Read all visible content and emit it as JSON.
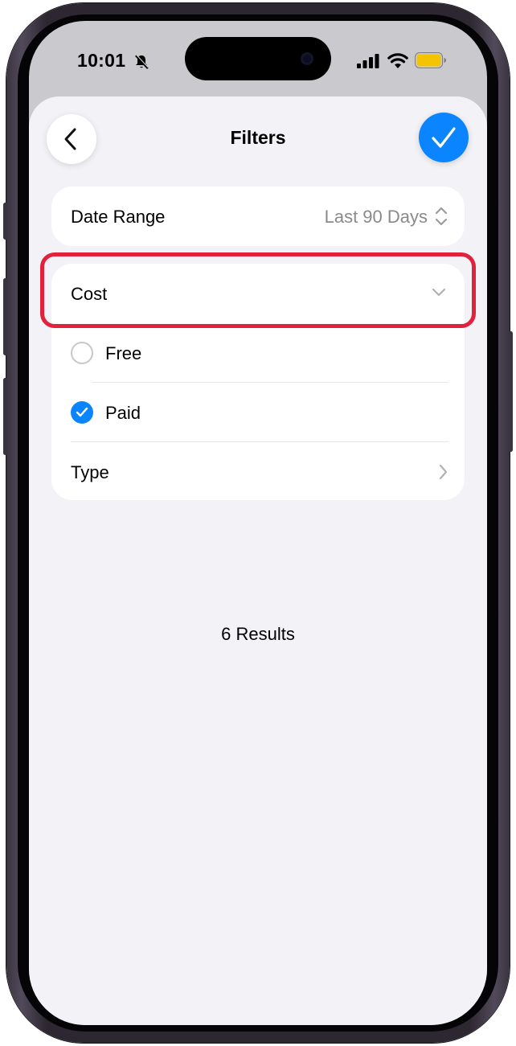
{
  "status": {
    "time": "10:01"
  },
  "nav": {
    "title": "Filters"
  },
  "filters": {
    "date_range": {
      "label": "Date Range",
      "value": "Last 90 Days"
    },
    "cost": {
      "label": "Cost",
      "options": [
        {
          "label": "Free",
          "selected": false
        },
        {
          "label": "Paid",
          "selected": true
        }
      ]
    },
    "type": {
      "label": "Type"
    }
  },
  "results": {
    "text": "6 Results"
  },
  "colors": {
    "accent": "#0a84ff",
    "highlight": "#e0223c",
    "background": "#f2f2f7"
  }
}
